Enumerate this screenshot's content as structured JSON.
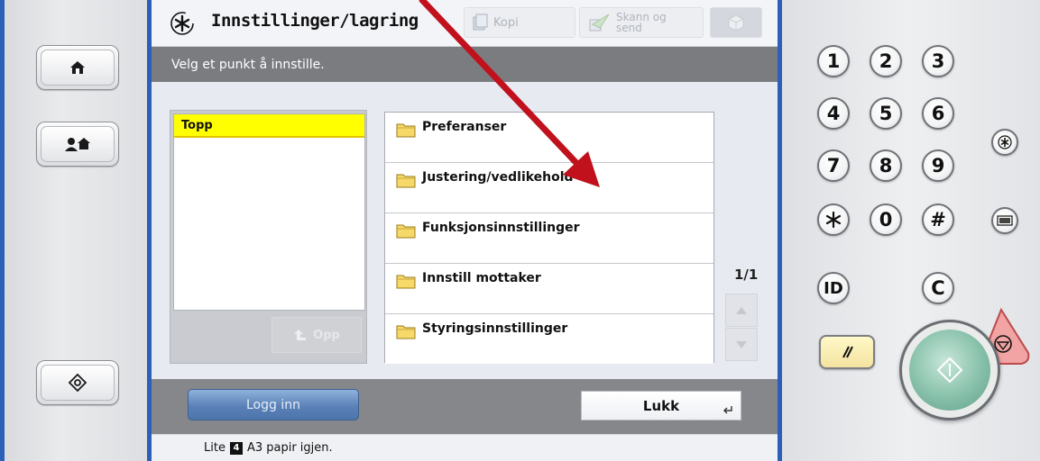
{
  "screen": {
    "title": "Innstillinger/lagring",
    "tabs": [
      {
        "label": "Kopi",
        "icon": "copy-icon"
      },
      {
        "label": "Skann og send",
        "icon": "scan-send-icon"
      },
      {
        "label": "",
        "icon": "box-icon"
      }
    ],
    "instruction": "Velg et punkt å innstille.",
    "tree": {
      "selected": "Topp",
      "up_button": "Opp"
    },
    "items": [
      {
        "label": "Preferanser",
        "icon": "folder-icon"
      },
      {
        "label": "Justering/vedlikehold",
        "icon": "folder-icon"
      },
      {
        "label": "Funksjonsinnstillinger",
        "icon": "folder-icon"
      },
      {
        "label": "Innstill mottaker",
        "icon": "folder-icon"
      },
      {
        "label": "Styringsinnstillinger",
        "icon": "folder-icon"
      }
    ],
    "pager": "1/1",
    "login_button": "Logg inn",
    "close_button": "Lukk",
    "status": {
      "prefix": "Lite",
      "tray": "4",
      "suffix": "A3  papir igjen."
    }
  },
  "keypad": {
    "digits": [
      "1",
      "2",
      "3",
      "4",
      "5",
      "6",
      "7",
      "8",
      "9"
    ],
    "star": "*",
    "zero": "0",
    "hash": "#",
    "id": "ID",
    "clear": "C"
  },
  "colors": {
    "arrow": "#c0111d",
    "accent_blue": "#2b5fb8",
    "selection_yellow": "#ffff00",
    "start_green": "#6fae99",
    "stop_red": "#e66d6d"
  }
}
